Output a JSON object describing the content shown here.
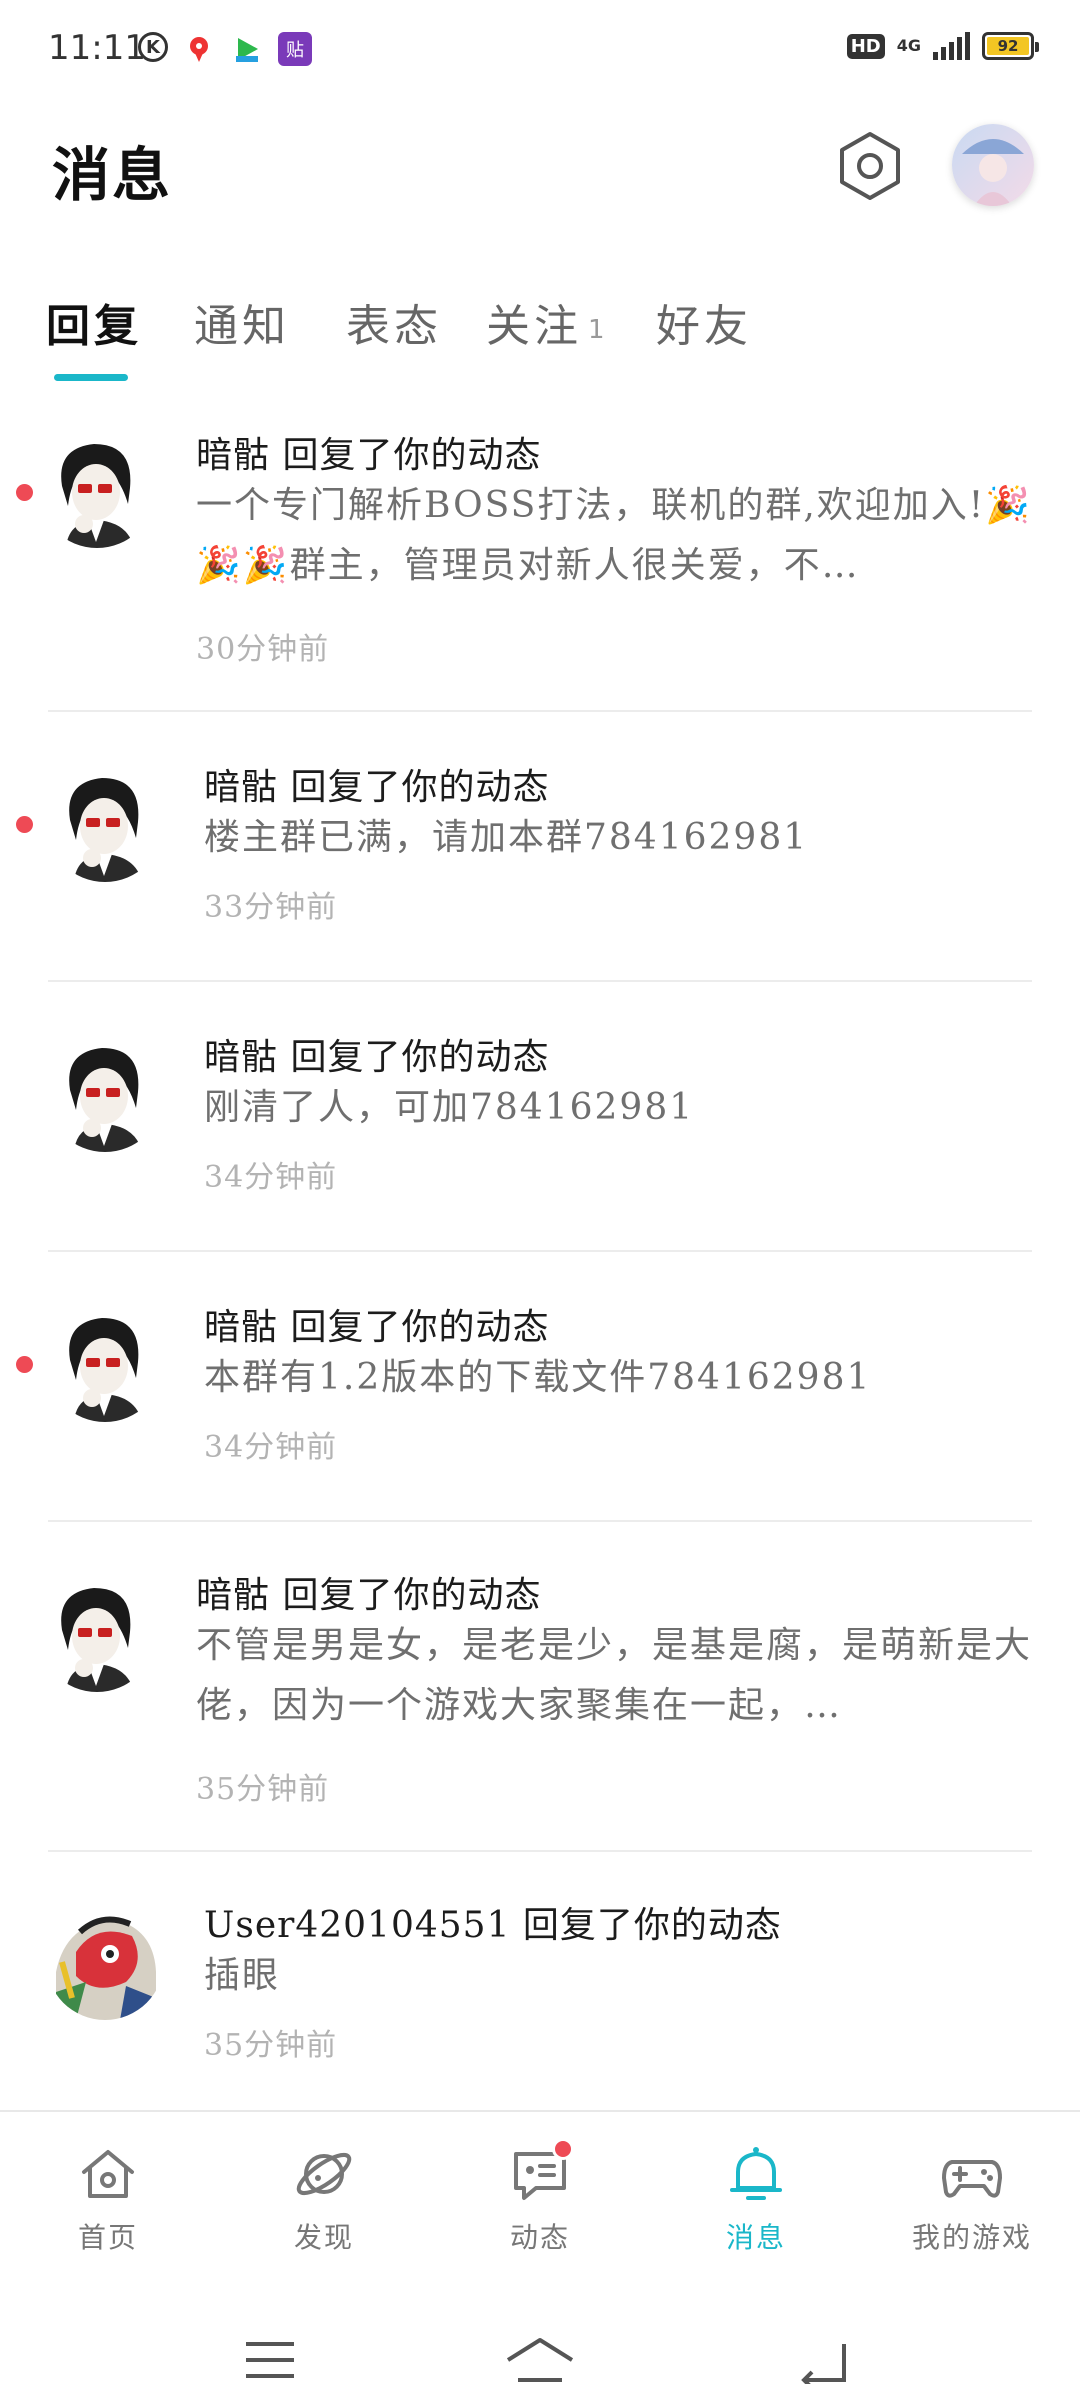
{
  "status_bar": {
    "time": "11:11",
    "hd": "HD",
    "network": "4G",
    "battery": "92",
    "battery_level": 0.92,
    "app_icons": [
      "k-icon",
      "map-pin-icon",
      "video-icon",
      "sticker-icon"
    ]
  },
  "header": {
    "title": "消息"
  },
  "tabs": [
    {
      "label": "回复",
      "active": true
    },
    {
      "label": "通知",
      "active": false
    },
    {
      "label": "表态",
      "active": false
    },
    {
      "label": "关注",
      "badge": "1",
      "active": false
    },
    {
      "label": "好友",
      "active": false
    }
  ],
  "messages": [
    {
      "title": "暗骷 回复了你的动态",
      "body": "一个专门解析BOSS打法，联机的群,欢迎加入!🎉🎉🎉群主，管理员对新人很关爱，不…",
      "time": "30分钟前",
      "unread": true
    },
    {
      "title": "暗骷 回复了你的动态",
      "body": "楼主群已满，请加本群784162981",
      "time": "33分钟前",
      "unread": true
    },
    {
      "title": "暗骷 回复了你的动态",
      "body": "刚清了人，可加784162981",
      "time": "34分钟前",
      "unread": false
    },
    {
      "title": "暗骷 回复了你的动态",
      "body": "本群有1.2版本的下载文件784162981",
      "time": "34分钟前",
      "unread": true
    },
    {
      "title": "暗骷 回复了你的动态",
      "body": "不管是男是女，是老是少，是基是腐，是萌新是大佬，因为一个游戏大家聚集在一起，…",
      "time": "35分钟前",
      "unread": false
    },
    {
      "title": "User420104551 回复了你的动态",
      "body": "插眼",
      "time": "35分钟前",
      "unread": false
    }
  ],
  "bottom_nav": [
    {
      "label": "首页",
      "icon": "home-icon"
    },
    {
      "label": "发现",
      "icon": "planet-icon"
    },
    {
      "label": "动态",
      "icon": "chat-icon",
      "dot": true
    },
    {
      "label": "消息",
      "icon": "bell-icon",
      "active": true
    },
    {
      "label": "我的游戏",
      "icon": "gamepad-icon"
    }
  ],
  "colors": {
    "accent": "#1ab7c9",
    "unread": "#ee4a55"
  }
}
